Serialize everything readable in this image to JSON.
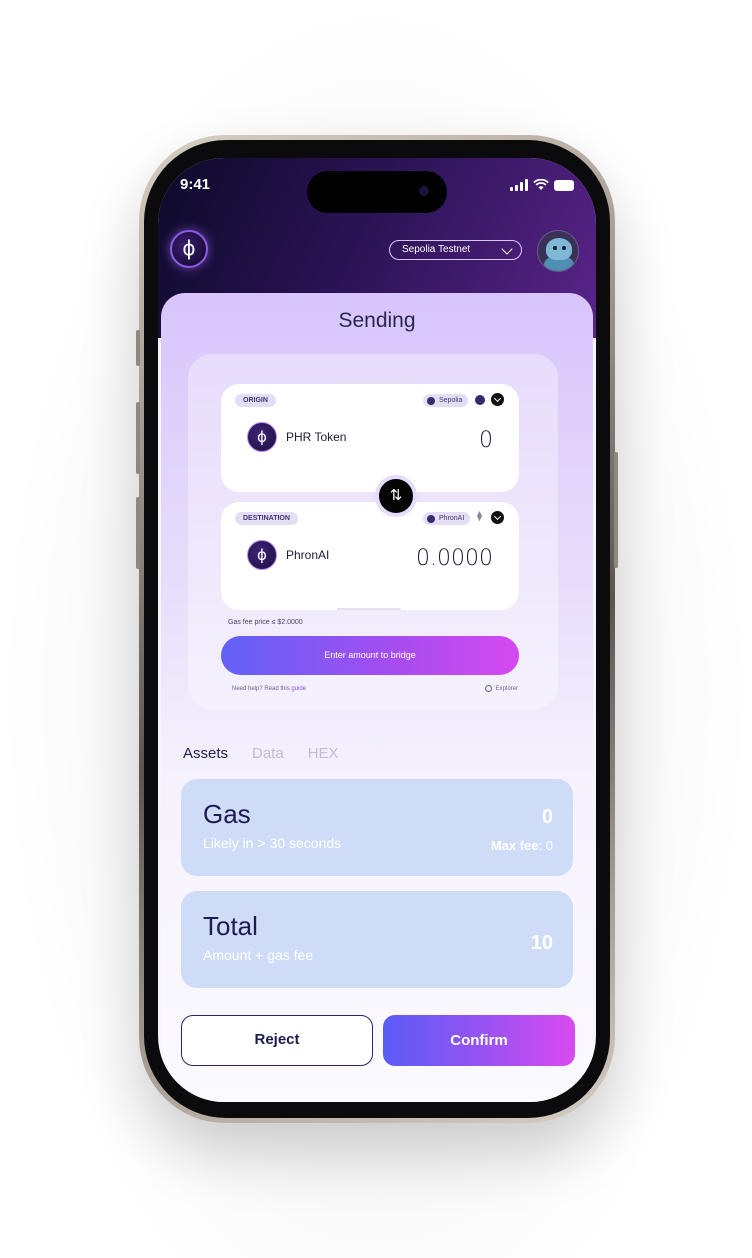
{
  "status_bar": {
    "time": "9:41"
  },
  "header": {
    "logo_glyph": "ϕ",
    "network": "Sepolia Testnet",
    "avatar_icon": "penguin-avatar"
  },
  "sheet": {
    "title": "Sending",
    "origin": {
      "label": "ORIGIN",
      "chain": "Sepolia",
      "token_glyph": "ϕ",
      "token_name": "PHR Token",
      "amount": "0"
    },
    "destination": {
      "label": "DESTINATION",
      "chain": "PhronAI",
      "token_glyph": "ϕ",
      "token_name": "PhronAI",
      "amount": "0.0000",
      "eth_glyph": "⧫"
    },
    "swap_glyph": "⇅",
    "gas_price": "Gas fee price ≤ $2.0000",
    "bridge_button": "Enter amount to bridge",
    "help_prefix": "Need help? Read this ",
    "help_link": "guide",
    "explorer": "Explorer"
  },
  "tabs": [
    {
      "label": "Assets",
      "active": true
    },
    {
      "label": "Data",
      "active": false
    },
    {
      "label": "HEX",
      "active": false
    }
  ],
  "gas_card": {
    "title": "Gas",
    "subtitle": "Likely in > 30 seconds",
    "value": "0",
    "max_fee_label": "Max fee",
    "max_fee_value": ": 0"
  },
  "total_card": {
    "title": "Total",
    "subtitle": "Amount + gas fee",
    "value": "10"
  },
  "actions": {
    "reject": "Reject",
    "confirm": "Confirm"
  },
  "colors": {
    "accent_start": "#5a5cf6",
    "accent_end": "#d94af0",
    "card_bg": "#cfdcf7",
    "header_bg": "#2a1354"
  }
}
